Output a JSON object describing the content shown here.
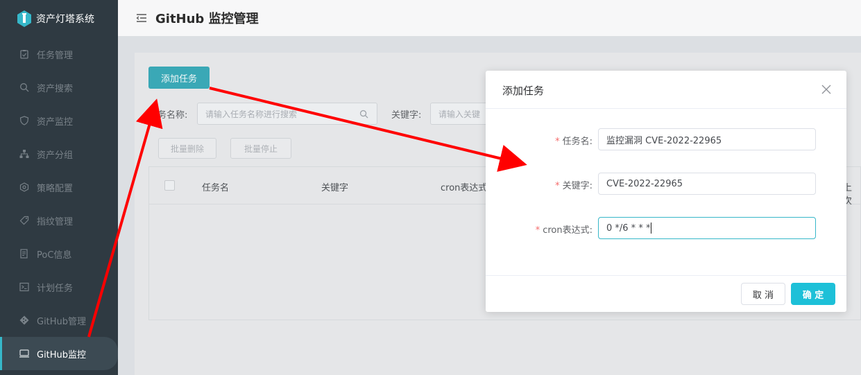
{
  "app": {
    "name": "资产灯塔系统"
  },
  "sidebar": {
    "items": [
      {
        "label": "任务管理",
        "icon": "clipboard-icon"
      },
      {
        "label": "资产搜索",
        "icon": "search-icon"
      },
      {
        "label": "资产监控",
        "icon": "shield-icon"
      },
      {
        "label": "资产分组",
        "icon": "sitemap-icon"
      },
      {
        "label": "策略配置",
        "icon": "settings-icon"
      },
      {
        "label": "指纹管理",
        "icon": "tag-icon"
      },
      {
        "label": "PoC信息",
        "icon": "document-icon"
      },
      {
        "label": "计划任务",
        "icon": "terminal-icon"
      },
      {
        "label": "GitHub管理",
        "icon": "git-icon"
      },
      {
        "label": "GitHub监控",
        "icon": "monitor-icon",
        "active": true
      }
    ]
  },
  "header": {
    "title": "GitHub 监控管理"
  },
  "main": {
    "add_button": "添加任务",
    "search": {
      "task_name_label": "任务名称:",
      "task_name_placeholder": "请输入任务名称进行搜索",
      "keyword_label": "关键字:",
      "keyword_placeholder": "请输入关键"
    },
    "batch_delete": "批量删除",
    "batch_stop": "批量停止",
    "table": {
      "columns": [
        "任务名",
        "关键字",
        "cron表达式",
        "上次"
      ]
    }
  },
  "modal": {
    "title": "添加任务",
    "fields": [
      {
        "label": "任务名:",
        "value": "监控漏洞 CVE-2022-22965",
        "required": true
      },
      {
        "label": "关键字:",
        "value": "CVE-2022-22965",
        "required": true
      },
      {
        "label": "cron表达式:",
        "value": "0 */6 * * *",
        "required": true
      }
    ],
    "cancel": "取 消",
    "confirm": "确 定"
  },
  "colors": {
    "accent": "#1dc0d8",
    "sidebar_bg": "#2f3a42",
    "annotation_arrow": "#ff0000"
  }
}
